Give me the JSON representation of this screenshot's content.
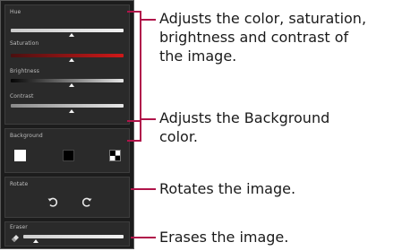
{
  "panel": {
    "adjust": {
      "sliders": [
        {
          "label": "Hue",
          "value": 0.52
        },
        {
          "label": "Saturation",
          "value": 0.52
        },
        {
          "label": "Brightness",
          "value": 0.52
        },
        {
          "label": "Contrast",
          "value": 0.52
        }
      ]
    },
    "background": {
      "label": "Background",
      "options": [
        "white-swatch",
        "black-swatch",
        "checker-swatch"
      ]
    },
    "rotate": {
      "label": "Rotate",
      "buttons": [
        "rotate-left-icon",
        "rotate-right-icon"
      ]
    },
    "eraser": {
      "label": "Eraser",
      "value": 0.12
    }
  },
  "callouts": {
    "adjust": [
      "Adjusts the color, saturation,",
      "brightness and contrast of",
      "the image."
    ],
    "background": [
      "Adjusts the Background",
      "color."
    ],
    "rotate": [
      "Rotates the image."
    ],
    "eraser": [
      "Erases the image."
    ]
  },
  "colors": {
    "callout_line": "#b0144a",
    "panel_bg": "#1c1c1c"
  }
}
